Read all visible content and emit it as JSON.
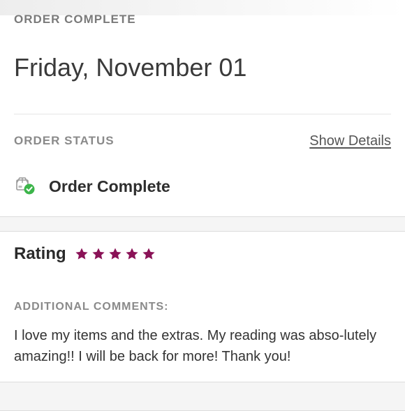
{
  "header": {
    "section_label": "ORDER COMPLETE",
    "date": "Friday, November 01"
  },
  "order_status": {
    "label": "ORDER STATUS",
    "show_details_label": "Show Details",
    "status_text": "Order Complete",
    "status_icon": "box-check-icon",
    "status_color": "#3cb54a"
  },
  "rating": {
    "label": "Rating",
    "stars": 5,
    "star_color": "#8a1257"
  },
  "comments": {
    "label": "ADDITIONAL COMMENTS:",
    "text": "I love my items and the extras. My reading was abso-lutely amazing!! I will be back for more! Thank you!"
  }
}
